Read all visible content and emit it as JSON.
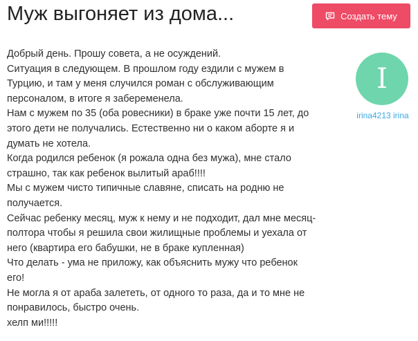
{
  "page": {
    "title": "Муж выгоняет из дома..."
  },
  "header": {
    "create_topic_label": "Создать тему",
    "create_topic_icon": "chat-bubble-icon",
    "accent_color": "#ee4b66"
  },
  "author": {
    "avatar_letter": "I",
    "avatar_color": "#6fd5ad",
    "username": "irina4213 irina"
  },
  "post": {
    "lines": [
      "Добрый день. Прошу совета, а не осуждений.",
      "Ситуация в следующем. В прошлом году ездили с мужем в",
      "Турцию, и там у меня случился роман с обслуживающим",
      "персоналом, в итоге я забеременела.",
      "Нам с мужем по 35 (оба ровесники) в браке уже почти 15 лет, до",
      "этого дети не получались. Естественно ни о каком аборте я и",
      "думать не хотела.",
      "Когда родился ребенок (я рожала одна без мужа), мне стало",
      "страшно, так как ребенок вылитый араб!!!!",
      "Мы с мужем чисто типичные славяне, списать на родню не",
      "получается.",
      "Сейчас ребенку месяц, муж к нему и не подходит, дал мне месяц-",
      "полтора чтобы я решила свои жилищные проблемы и уехала от",
      "него (квартира его бабушки, не в браке купленная)",
      "Что делать - ума не приложу, как объяснить мужу что ребенок",
      "его!",
      "Не могла я от араба залететь, от одного то раза, да и то мне не",
      "понравилось, быстро очень.",
      "хелп ми!!!!!"
    ]
  }
}
